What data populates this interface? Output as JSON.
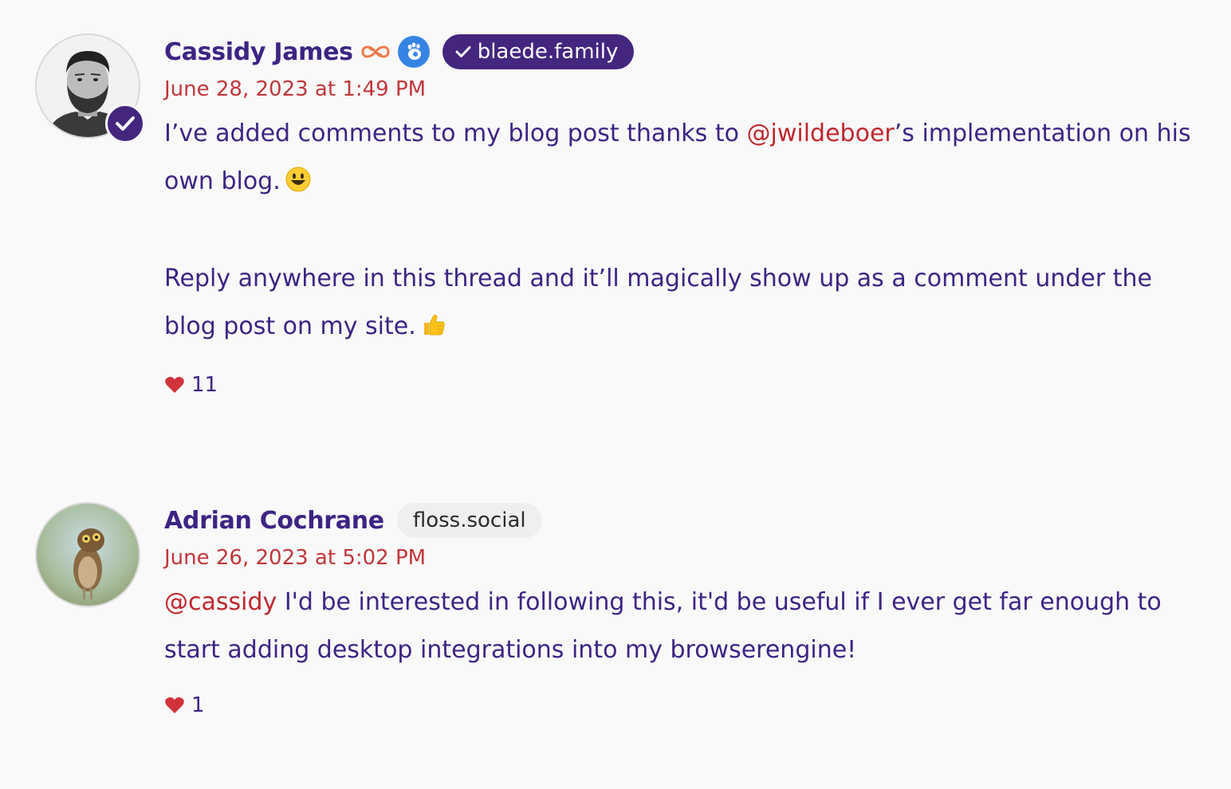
{
  "comments": [
    {
      "author": "Cassidy James",
      "instance": "blaede.family",
      "instance_verified": true,
      "date": "June 28, 2023 at 1:49 PM",
      "text_before_mention": "I’ve added comments to my blog post thanks to ",
      "mention": "@jwildeboer",
      "text_after_mention": "’s implementation on his own blog.",
      "second_paragraph": "Reply anywhere in this thread and it’ll magically show up as a comment under the blog post on my site.",
      "likes": "11",
      "avatar_verified": true
    },
    {
      "author": "Adrian Cochrane",
      "instance": "floss.social",
      "instance_verified": false,
      "date": "June 26, 2023 at 5:02 PM",
      "mention": "@cassidy",
      "text_after_mention": " I'd be interested in following this, it'd be useful if I ever get far enough to start adding desktop integrations into my browserengine!",
      "likes": "1"
    }
  ],
  "colors": {
    "author": "#3d2484",
    "date": "#c0363a",
    "mention": "#c0272d",
    "verified_pill": "#44267f",
    "heart": "#d1323b",
    "background": "#f9f9f9"
  },
  "icons": [
    "verified-check-icon",
    "infinity-icon",
    "gnome-foot-icon",
    "checkmark-icon",
    "heart-icon",
    "smiley-emoji",
    "thumbs-up-emoji"
  ]
}
